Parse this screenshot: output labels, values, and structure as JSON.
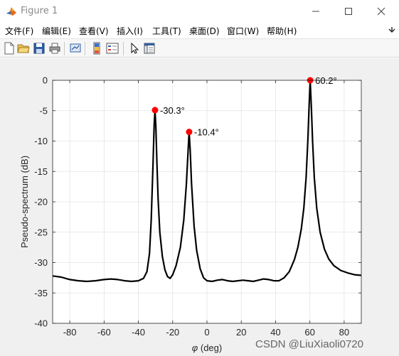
{
  "window": {
    "title": "Figure 1"
  },
  "menu": [
    {
      "label": "文件(F)"
    },
    {
      "label": "编辑(E)"
    },
    {
      "label": "查看(V)"
    },
    {
      "label": "插入(I)"
    },
    {
      "label": "工具(T)"
    },
    {
      "label": "桌面(D)"
    },
    {
      "label": "窗口(W)"
    },
    {
      "label": "帮助(H)"
    }
  ],
  "toolbar": [
    {
      "icon": "new-figure-icon"
    },
    {
      "icon": "open-file-icon"
    },
    {
      "icon": "save-icon"
    },
    {
      "icon": "print-icon"
    },
    {
      "icon": "link-plot-icon"
    },
    {
      "icon": "insert-colorbar-icon"
    },
    {
      "icon": "insert-legend-icon"
    },
    {
      "icon": "edit-plot-icon"
    },
    {
      "icon": "property-inspector-icon"
    }
  ],
  "chart_data": {
    "type": "line",
    "xlabel_symbol": "φ",
    "xlabel": "(deg)",
    "ylabel": "Pseudo-spectrum (dB)",
    "xlim": [
      -90,
      90
    ],
    "ylim": [
      -40,
      0
    ],
    "xticks": [
      -80,
      -60,
      -40,
      -20,
      0,
      20,
      40,
      60,
      80
    ],
    "yticks": [
      0,
      -5,
      -10,
      -15,
      -20,
      -25,
      -30,
      -35,
      -40
    ],
    "grid": true,
    "line_color": "#000000",
    "marker_color": "#ff0000",
    "series": [
      {
        "points": [
          [
            -90,
            -32.2
          ],
          [
            -85,
            -32.4
          ],
          [
            -80,
            -32.8
          ],
          [
            -75,
            -33.0
          ],
          [
            -70,
            -33.1
          ],
          [
            -65,
            -33.0
          ],
          [
            -60,
            -32.8
          ],
          [
            -56,
            -32.7
          ],
          [
            -52,
            -32.8
          ],
          [
            -48,
            -33.0
          ],
          [
            -44,
            -33.1
          ],
          [
            -40,
            -33.0
          ],
          [
            -37,
            -32.6
          ],
          [
            -35,
            -31.5
          ],
          [
            -33.5,
            -28.5
          ],
          [
            -32.5,
            -23.0
          ],
          [
            -31.5,
            -14.0
          ],
          [
            -30.8,
            -7.5
          ],
          [
            -30.3,
            -4.9
          ],
          [
            -29.8,
            -7.5
          ],
          [
            -29.2,
            -13.5
          ],
          [
            -28.5,
            -19.5
          ],
          [
            -27.5,
            -25.0
          ],
          [
            -26.0,
            -29.0
          ],
          [
            -24.5,
            -31.2
          ],
          [
            -23.0,
            -32.3
          ],
          [
            -21.5,
            -32.6
          ],
          [
            -20.0,
            -32.0
          ],
          [
            -18.0,
            -30.5
          ],
          [
            -15.5,
            -27.5
          ],
          [
            -13.5,
            -23.0
          ],
          [
            -12.0,
            -17.0
          ],
          [
            -11.0,
            -11.5
          ],
          [
            -10.4,
            -8.5
          ],
          [
            -9.8,
            -11.5
          ],
          [
            -9.0,
            -17.0
          ],
          [
            -7.5,
            -24.0
          ],
          [
            -6.0,
            -28.0
          ],
          [
            -4.0,
            -31.0
          ],
          [
            -2.0,
            -32.5
          ],
          [
            0,
            -33.0
          ],
          [
            3,
            -33.1
          ],
          [
            6,
            -32.9
          ],
          [
            9,
            -32.8
          ],
          [
            12,
            -33.0
          ],
          [
            15,
            -33.1
          ],
          [
            18,
            -33.0
          ],
          [
            21,
            -32.9
          ],
          [
            24,
            -33.0
          ],
          [
            27,
            -33.1
          ],
          [
            30,
            -32.9
          ],
          [
            33,
            -32.7
          ],
          [
            36,
            -32.8
          ],
          [
            39,
            -33.0
          ],
          [
            42,
            -33.0
          ],
          [
            45,
            -32.5
          ],
          [
            48,
            -31.5
          ],
          [
            51,
            -29.5
          ],
          [
            53,
            -27.5
          ],
          [
            55,
            -24.5
          ],
          [
            56.5,
            -21.0
          ],
          [
            57.8,
            -16.0
          ],
          [
            58.8,
            -10.0
          ],
          [
            59.5,
            -4.5
          ],
          [
            60.2,
            0
          ],
          [
            60.9,
            -4.5
          ],
          [
            61.6,
            -10.0
          ],
          [
            62.6,
            -16.0
          ],
          [
            64.0,
            -21.0
          ],
          [
            66.0,
            -25.0
          ],
          [
            68.5,
            -27.8
          ],
          [
            71,
            -29.4
          ],
          [
            74,
            -30.5
          ],
          [
            78,
            -31.3
          ],
          [
            82,
            -31.7
          ],
          [
            86,
            -32.0
          ],
          [
            90,
            -32.1
          ]
        ]
      }
    ],
    "peaks": [
      {
        "x": -30.3,
        "y": -4.9,
        "label": "-30.3°"
      },
      {
        "x": -10.4,
        "y": -8.5,
        "label": "-10.4°"
      },
      {
        "x": 60.2,
        "y": 0,
        "label": "60.2°"
      }
    ]
  },
  "watermark": "CSDN @LiuXiaoli0720"
}
